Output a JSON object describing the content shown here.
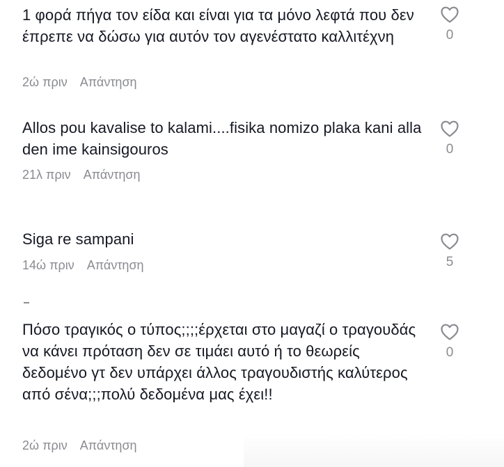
{
  "comments": [
    {
      "text": "1 φορά πήγα τον είδα και είναι για τα μόνο λεφτά που δεν έπρεπε να δώσω για αυτόν τον αγενέστατο καλλιτέχνη",
      "time": "2ώ πριν",
      "reply": "Απάντηση",
      "likes": "0"
    },
    {
      "text": "Allos pou kavalise to kalami....fisika nomizo plaka kani alla den ime kainsigouros",
      "time": "21λ πριν",
      "reply": "Απάντηση",
      "likes": "0"
    },
    {
      "text": "Siga re sampani",
      "time": "14ώ πριν",
      "reply": "Απάντηση",
      "likes": "5"
    },
    {
      "text": "Πόσο τραγικός ο τύπος;;;;έρχεται στο μαγαζί ο τραγουδάς να κάνει πρόταση δεν σε τιμάει αυτό ή το θεωρείς δεδομένο γτ δεν υπάρχει άλλος τραγουδιστής καλύτερος από σένα;;;πολύ δεδομένα μας έχει!!",
      "time": "2ώ πριν",
      "reply": "Απάντηση",
      "likes": "0"
    }
  ],
  "icons": {
    "like": "heart-outline-icon"
  },
  "colors": {
    "text": "#161823",
    "muted": "#8a8b91"
  }
}
